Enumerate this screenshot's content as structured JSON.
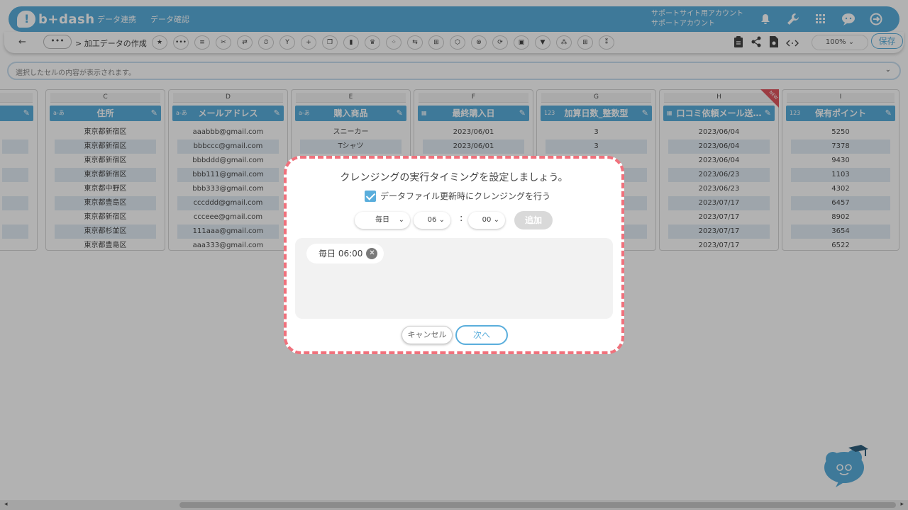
{
  "app": {
    "logo_text": "b+dash"
  },
  "topnav": {
    "items": [
      "データ連携",
      "データ確認"
    ]
  },
  "account": {
    "line1": "サポートサイト用アカウント",
    "line2": "サポートアカウント"
  },
  "toolbar": {
    "back": "←",
    "more": "•••",
    "breadcrumb": "> 加工データの作成",
    "icons": [
      "★",
      "•••",
      "≡",
      "✂",
      "⇄",
      "⏱",
      "Y",
      "+",
      "❐",
      "▮",
      "♛",
      "⁘",
      "⇆",
      "⊞",
      "⬡",
      "⊗",
      "⟳",
      "▣",
      "▼",
      "⁂",
      "⊞",
      "⁑"
    ],
    "zoom": "100%",
    "save_label": "保存"
  },
  "formula_bar": {
    "placeholder": "選択したセルの内容が表示されます。"
  },
  "columns": [
    {
      "letter": "",
      "header": "",
      "type": "",
      "cells": [
        "",
        "",
        "",
        "",
        "",
        "",
        "",
        "",
        ""
      ]
    },
    {
      "letter": "C",
      "header": "住所",
      "type": "a-あ",
      "cells": [
        "東京都新宿区",
        "東京都新宿区",
        "東京都新宿区",
        "東京都新宿区",
        "東京都中野区",
        "東京都豊島区",
        "東京都新宿区",
        "東京都杉並区",
        "東京都豊島区"
      ]
    },
    {
      "letter": "D",
      "header": "メールアドレス",
      "type": "a-あ",
      "cells": [
        "aaabbb@gmail.com",
        "bbbccc@gmail.com",
        "bbbddd@gmail.com",
        "bbb111@gmail.com",
        "bbb333@gmail.com",
        "cccddd@gmail.com",
        "ccceee@gmail.com",
        "111aaa@gmail.com",
        "aaa333@gmail.com"
      ]
    },
    {
      "letter": "E",
      "header": "購入商品",
      "type": "a-あ",
      "cells": [
        "スニーカー",
        "Tシャツ",
        "",
        "",
        "",
        "",
        "",
        "",
        ""
      ]
    },
    {
      "letter": "F",
      "header": "最終購入日",
      "type": "cal",
      "cells": [
        "2023/06/01",
        "2023/06/01",
        "",
        "",
        "",
        "",
        "",
        "",
        ""
      ]
    },
    {
      "letter": "G",
      "header": "加算日数_整数型",
      "type": "123",
      "cells": [
        "3",
        "3",
        "",
        "",
        "",
        "",
        "",
        "",
        ""
      ]
    },
    {
      "letter": "H",
      "header": "口コミ依頼メール送…",
      "type": "cal",
      "new": "NEW",
      "cells": [
        "2023/06/04",
        "2023/06/04",
        "2023/06/04",
        "2023/06/23",
        "2023/06/23",
        "2023/07/17",
        "2023/07/17",
        "2023/07/17",
        "2023/07/17"
      ]
    },
    {
      "letter": "I",
      "header": "保有ポイント",
      "type": "123",
      "cells": [
        "5250",
        "7378",
        "9430",
        "1103",
        "4302",
        "6457",
        "8902",
        "3654",
        "6522"
      ]
    }
  ],
  "modal": {
    "title": "クレンジングの実行タイミングを設定しましょう。",
    "checkbox_label": "データファイル更新時にクレンジングを行う",
    "checkbox_checked": true,
    "frequency": "毎日",
    "hour": "06",
    "minute": "00",
    "colon": ":",
    "add_label": "追加",
    "schedules": [
      "毎日 06:00"
    ],
    "cancel_label": "キャンセル",
    "next_label": "次へ"
  },
  "colors": {
    "accent": "#5aaedc",
    "highlight_border": "#f0717c"
  }
}
